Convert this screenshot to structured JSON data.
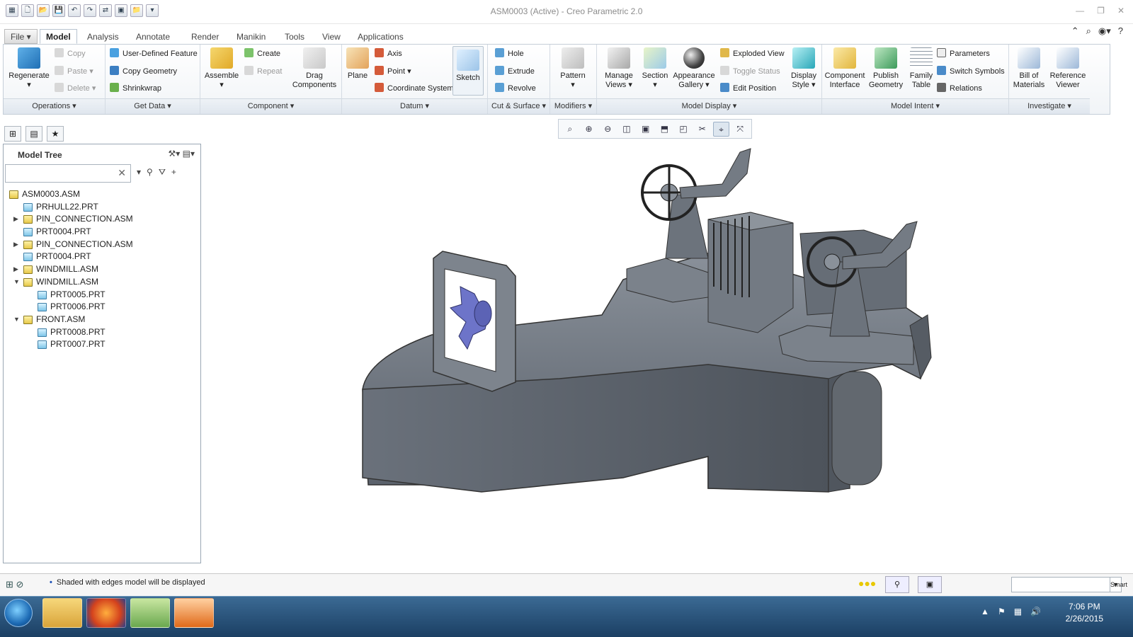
{
  "window": {
    "title": "ASM0003 (Active) - Creo Parametric 2.0",
    "controls": [
      "—",
      "❐",
      "✕"
    ]
  },
  "quick_access": [
    "▦",
    "🗋",
    "📂",
    "💾",
    "↶",
    "↷",
    "⇄",
    "▣",
    "📁",
    "▾"
  ],
  "tabs": [
    "File ▾",
    "Model",
    "Analysis",
    "Annotate",
    "Render",
    "Manikin",
    "Tools",
    "View",
    "Applications"
  ],
  "ribbon": {
    "operations": {
      "label": "Operations ▾",
      "regenerate": "Regenerate",
      "copy": "Copy",
      "paste": "Paste",
      "delete": "Delete"
    },
    "get_data": {
      "label": "Get Data ▾",
      "udf": "User-Defined Feature",
      "copy_geometry": "Copy Geometry",
      "shrinkwrap": "Shrinkwrap"
    },
    "component": {
      "label": "Component ▾",
      "assemble": "Assemble",
      "create": "Create",
      "repeat": "Repeat",
      "drag": "Drag Components"
    },
    "datum": {
      "label": "Datum ▾",
      "plane": "Plane",
      "axis": "Axis",
      "point": "Point",
      "csys": "Coordinate System",
      "sketch": "Sketch"
    },
    "cut_surface": {
      "label": "Cut & Surface ▾",
      "hole": "Hole",
      "extrude": "Extrude",
      "revolve": "Revolve"
    },
    "modifiers": {
      "label": "Modifiers ▾",
      "pattern": "Pattern"
    },
    "model_display": {
      "label": "Model Display ▾",
      "manage_views": "Manage Views",
      "section": "Section",
      "appearance": "Appearance Gallery",
      "exploded": "Exploded View",
      "toggle": "Toggle Status",
      "edit_position": "Edit Position",
      "display_style": "Display Style"
    },
    "model_intent": {
      "label": "Model Intent ▾",
      "component_interface": "Component Interface",
      "publish_geometry": "Publish Geometry",
      "family_table": "Family Table",
      "parameters": "Parameters",
      "switch_symbols": "Switch Symbols",
      "relations": "Relations"
    },
    "investigate": {
      "label": "Investigate ▾",
      "bom": "Bill of Materials",
      "reference_viewer": "Reference Viewer"
    }
  },
  "model_tree": {
    "title": "Model Tree",
    "search_value": "",
    "nodes": [
      {
        "label": "ASM0003.ASM",
        "level": 0,
        "expander": "",
        "kind": "asm"
      },
      {
        "label": "PRHULL22.PRT",
        "level": 1,
        "expander": "",
        "kind": "prt"
      },
      {
        "label": "PIN_CONNECTION.ASM",
        "level": 1,
        "expander": "▶",
        "kind": "asm"
      },
      {
        "label": "PRT0004.PRT",
        "level": 1,
        "expander": "",
        "kind": "prt"
      },
      {
        "label": "PIN_CONNECTION.ASM",
        "level": 1,
        "expander": "▶",
        "kind": "asm"
      },
      {
        "label": "PRT0004.PRT",
        "level": 1,
        "expander": "",
        "kind": "prt"
      },
      {
        "label": "WINDMILL.ASM",
        "level": 1,
        "expander": "▶",
        "kind": "asm"
      },
      {
        "label": "WINDMILL.ASM",
        "level": 1,
        "expander": "▼",
        "kind": "asm"
      },
      {
        "label": "PRT0005.PRT",
        "level": 2,
        "expander": "",
        "kind": "prt"
      },
      {
        "label": "PRT0006.PRT",
        "level": 2,
        "expander": "",
        "kind": "prt"
      },
      {
        "label": "FRONT.ASM",
        "level": 1,
        "expander": "▼",
        "kind": "asm"
      },
      {
        "label": "PRT0008.PRT",
        "level": 2,
        "expander": "",
        "kind": "prt"
      },
      {
        "label": "PRT0007.PRT",
        "level": 2,
        "expander": "",
        "kind": "prt"
      }
    ]
  },
  "view_toolbar": [
    "⌕",
    "⊕",
    "⊖",
    "◫",
    "▣",
    "⬒",
    "◰",
    "✂",
    "⌖",
    "⤧"
  ],
  "status": {
    "message": "Shaded with edges model will be displayed",
    "filter": "Smart"
  },
  "taskbar": {
    "time": "7:06 PM",
    "date": "2/26/2015"
  },
  "colors": {
    "model": "#747c86",
    "accent": "#1a4fb5",
    "blade": "#6d74c9"
  }
}
